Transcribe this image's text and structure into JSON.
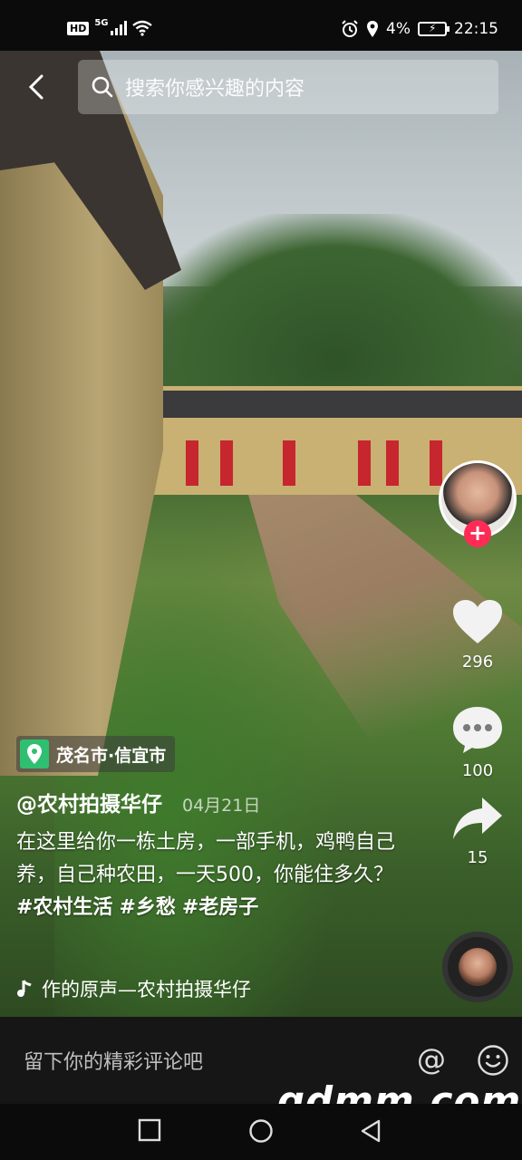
{
  "status_bar": {
    "hd": "HD",
    "network": "5G",
    "battery": "4%",
    "time": "22:15"
  },
  "search": {
    "placeholder": "搜索你感兴趣的内容"
  },
  "actions": {
    "likes": "296",
    "comments": "100",
    "shares": "15"
  },
  "video": {
    "location": "茂名市·信宜市",
    "author": "@农村拍摄华仔",
    "date": "04月21日",
    "description": "在这里给你一栋土房，一部手机，鸡鸭自己养，自己种农田，一天500，你能住多久？",
    "tags": [
      "#农村生活",
      "#乡愁",
      "#老房子"
    ],
    "music": "作的原声—农村拍摄华仔"
  },
  "comment_bar": {
    "placeholder": "留下你的精彩评论吧",
    "at_symbol": "@"
  },
  "watermark": "gdmm.com",
  "colors": {
    "follow_badge": "#fe2c55",
    "location_pin": "#2fbf71"
  }
}
